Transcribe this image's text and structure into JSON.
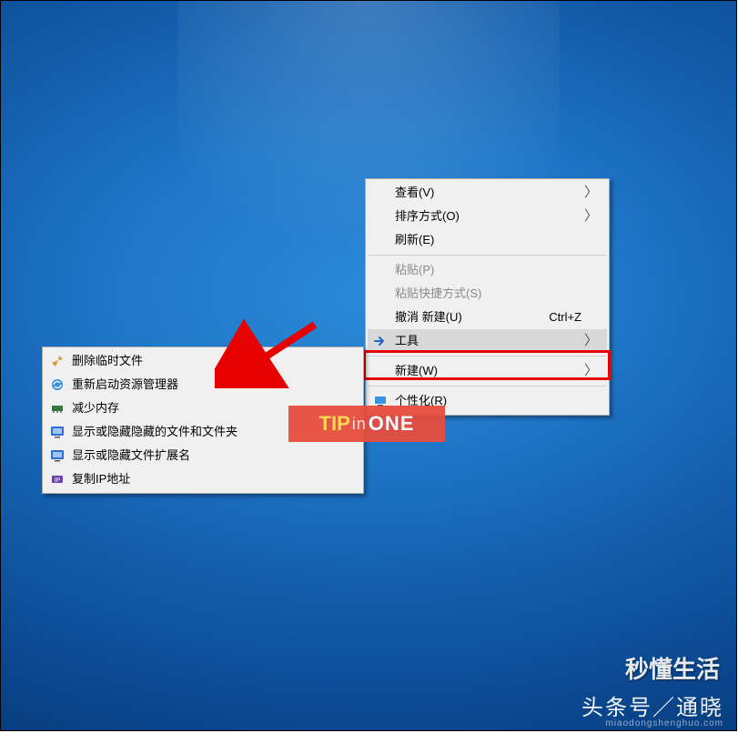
{
  "context_menu": {
    "items": [
      {
        "label": "查看(V)",
        "submenu": true,
        "disabled": false
      },
      {
        "label": "排序方式(O)",
        "submenu": true,
        "disabled": false
      },
      {
        "label": "刷新(E)",
        "submenu": false,
        "disabled": false
      },
      {
        "sep": true
      },
      {
        "label": "粘贴(P)",
        "submenu": false,
        "disabled": true
      },
      {
        "label": "粘贴快捷方式(S)",
        "submenu": false,
        "disabled": true
      },
      {
        "label": "撤消 新建(U)",
        "submenu": false,
        "disabled": false,
        "shortcut": "Ctrl+Z"
      },
      {
        "label": "工具",
        "submenu": true,
        "disabled": false,
        "icon": "arrow-right-blue",
        "highlight": true
      },
      {
        "sep": true
      },
      {
        "label": "新建(W)",
        "submenu": true,
        "disabled": false
      },
      {
        "sep": true
      },
      {
        "label": "个性化(R)",
        "submenu": false,
        "disabled": false,
        "icon": "personalize"
      }
    ]
  },
  "tools_submenu": {
    "items": [
      {
        "label": "删除临时文件",
        "icon": "broom"
      },
      {
        "label": "重新启动资源管理器",
        "icon": "globe-refresh"
      },
      {
        "label": "减少内存",
        "icon": "ram-chip"
      },
      {
        "label": "显示或隐藏隐藏的文件和文件夹",
        "icon": "monitor-toggle"
      },
      {
        "label": "显示或隐藏文件扩展名",
        "icon": "monitor-toggle"
      },
      {
        "label": "复制IP地址",
        "icon": "ip-copy"
      }
    ]
  },
  "watermark": {
    "tip": "TIP",
    "in": "in",
    "one": "ONE"
  },
  "branding": {
    "miaodong": "秒懂生活",
    "footer_main": "头条号／通晓",
    "footer_sub": "miaodongshenghuo.com"
  }
}
